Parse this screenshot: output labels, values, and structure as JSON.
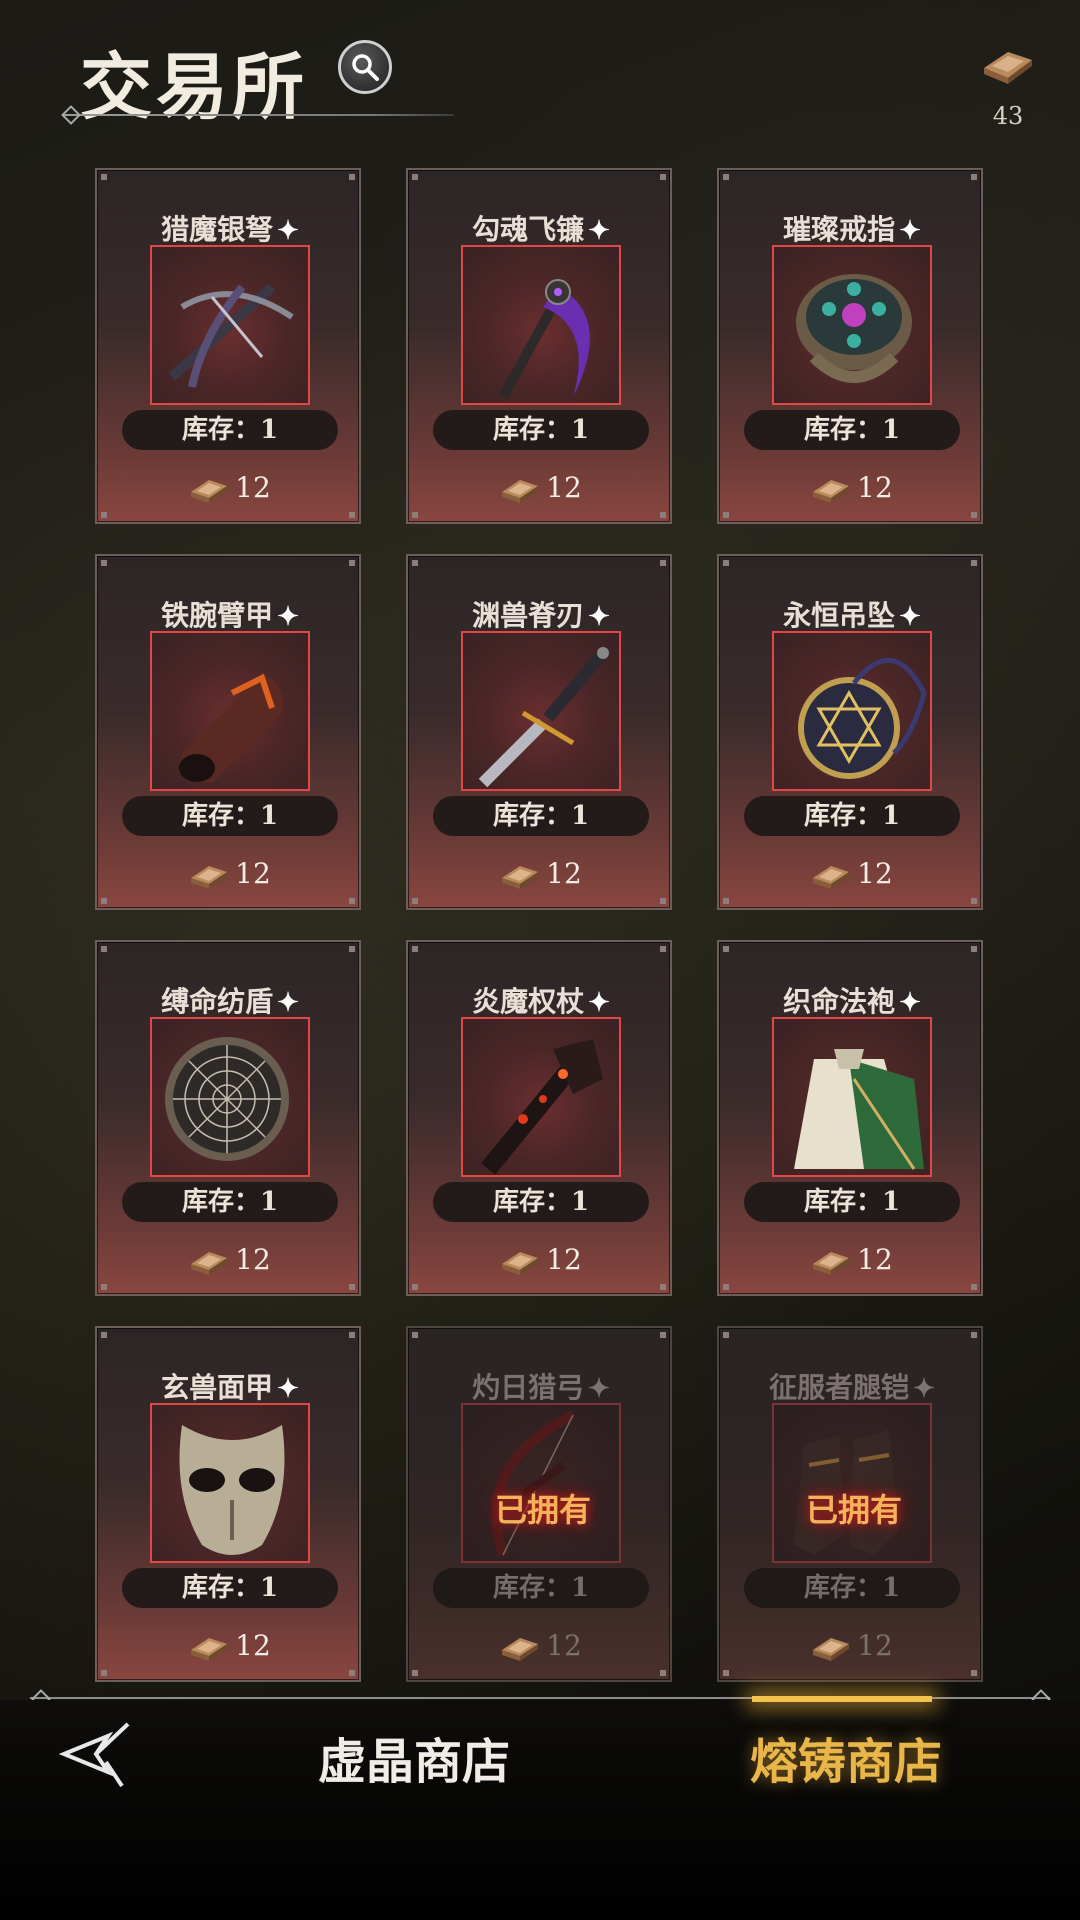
{
  "header": {
    "title": "交易所",
    "currency_count": "43"
  },
  "stock_prefix": "库存：",
  "items": [
    {
      "name": "猎魔银弩",
      "stock": "库存：1",
      "price": "12",
      "owned": false,
      "icon": "crossbow"
    },
    {
      "name": "勾魂飞镰",
      "stock": "库存：1",
      "price": "12",
      "owned": false,
      "icon": "scythe"
    },
    {
      "name": "璀璨戒指",
      "stock": "库存：1",
      "price": "12",
      "owned": false,
      "icon": "ring"
    },
    {
      "name": "铁腕臂甲",
      "stock": "库存：1",
      "price": "12",
      "owned": false,
      "icon": "bracer"
    },
    {
      "name": "渊兽脊刃",
      "stock": "库存：1",
      "price": "12",
      "owned": false,
      "icon": "dagger"
    },
    {
      "name": "永恒吊坠",
      "stock": "库存：1",
      "price": "12",
      "owned": false,
      "icon": "pendant"
    },
    {
      "name": "缚命纺盾",
      "stock": "库存：1",
      "price": "12",
      "owned": false,
      "icon": "web-shield"
    },
    {
      "name": "炎魔权杖",
      "stock": "库存：1",
      "price": "12",
      "owned": false,
      "icon": "scepter"
    },
    {
      "name": "织命法袍",
      "stock": "库存：1",
      "price": "12",
      "owned": false,
      "icon": "robe"
    },
    {
      "name": "玄兽面甲",
      "stock": "库存：1",
      "price": "12",
      "owned": false,
      "icon": "mask"
    },
    {
      "name": "灼日猎弓",
      "stock": "库存：1",
      "price": "12",
      "owned": true,
      "owned_label": "已拥有",
      "icon": "bow"
    },
    {
      "name": "征服者腿铠",
      "stock": "库存：1",
      "price": "12",
      "owned": true,
      "owned_label": "已拥有",
      "icon": "greaves"
    }
  ],
  "tabs": [
    {
      "label": "虚晶商店",
      "active": false
    },
    {
      "label": "熔铸商店",
      "active": true
    }
  ],
  "colors": {
    "accent_gold": "#e9b64a",
    "frame_red": "#e04848",
    "owned_text": "#f4b35a"
  }
}
